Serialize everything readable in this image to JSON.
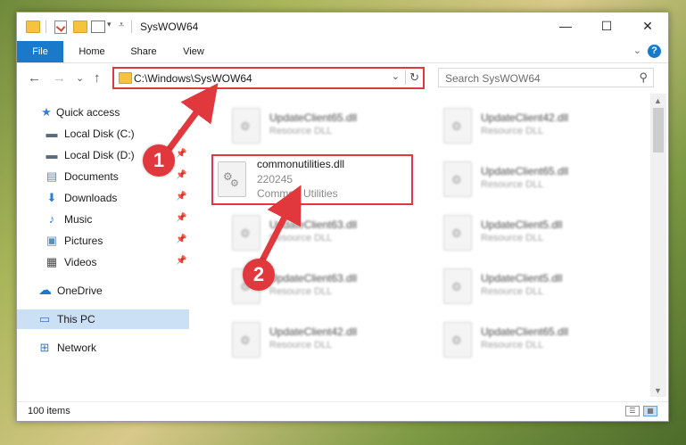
{
  "window": {
    "title": "SysWOW64",
    "controls": {
      "minimize": "—",
      "maximize": "☐",
      "close": "✕"
    }
  },
  "ribbon": {
    "tabs": [
      "File",
      "Home",
      "Share",
      "View"
    ],
    "help": "?",
    "chevron": "⌄"
  },
  "nav": {
    "back": "←",
    "forward": "→",
    "recent": "⌄",
    "up": "↑"
  },
  "address": {
    "path": "C:\\Windows\\SysWOW64",
    "dropdown": "⌄",
    "refresh": "↻"
  },
  "search": {
    "placeholder": "Search SysWOW64",
    "icon": "⚲"
  },
  "sidebar": {
    "items": [
      {
        "label": "Quick access",
        "icon": "star-icon",
        "glyph": "★",
        "color": "#2f7fd4"
      },
      {
        "label": "Local Disk (C:)",
        "icon": "drive-icon",
        "glyph": "▬",
        "color": "#5a6b7d",
        "pinned": true
      },
      {
        "label": "Local Disk (D:)",
        "icon": "drive-icon",
        "glyph": "▬",
        "color": "#5a6b7d",
        "pinned": true
      },
      {
        "label": "Documents",
        "icon": "documents-icon",
        "glyph": "▤",
        "color": "#6e87a3",
        "pinned": true
      },
      {
        "label": "Downloads",
        "icon": "downloads-icon",
        "glyph": "⬇",
        "color": "#2f7fd4",
        "pinned": true
      },
      {
        "label": "Music",
        "icon": "music-icon",
        "glyph": "♪",
        "color": "#2f7fd4",
        "pinned": true
      },
      {
        "label": "Pictures",
        "icon": "pictures-icon",
        "glyph": "▣",
        "color": "#5b8cc4",
        "pinned": true
      },
      {
        "label": "Videos",
        "icon": "videos-icon",
        "glyph": "▦",
        "color": "#4a4a4a",
        "pinned": true
      },
      {
        "label": "OneDrive",
        "icon": "onedrive-icon",
        "glyph": "☁",
        "color": "#1979ca"
      },
      {
        "label": "This PC",
        "icon": "computer-icon",
        "glyph": "▭",
        "color": "#3b78c4",
        "selected": true
      },
      {
        "label": "Network",
        "icon": "network-icon",
        "glyph": "⊞",
        "color": "#3b78c4"
      }
    ],
    "pin_glyph": "📌"
  },
  "files": {
    "background": [
      {
        "name": "UpdateClient65.dll",
        "desc": "Resource DLL"
      },
      {
        "name": "UpdateClient42.dll",
        "desc": "Resource DLL"
      },
      {
        "name": "UpdateClient65.dll",
        "desc": "Resource DLL"
      },
      {
        "name": "UpdateClient63.dll",
        "desc": "Resource DLL"
      },
      {
        "name": "UpdateClient5.dll",
        "desc": "Resource DLL"
      },
      {
        "name": "UpdateClient63.dll",
        "desc": "Resource DLL"
      },
      {
        "name": "UpdateClient5.dll",
        "desc": "Resource DLL"
      },
      {
        "name": "UpdateClient42.dll",
        "desc": "Resource DLL"
      },
      {
        "name": "UpdateClient65.dll",
        "desc": "Resource DLL"
      }
    ],
    "highlighted": {
      "name": "commonutilities.dll",
      "size": "220245",
      "desc": "Common Utilities"
    }
  },
  "status": {
    "items_count": "100 items"
  },
  "annotations": {
    "step1": "1",
    "step2": "2",
    "color": "#e0383d"
  }
}
